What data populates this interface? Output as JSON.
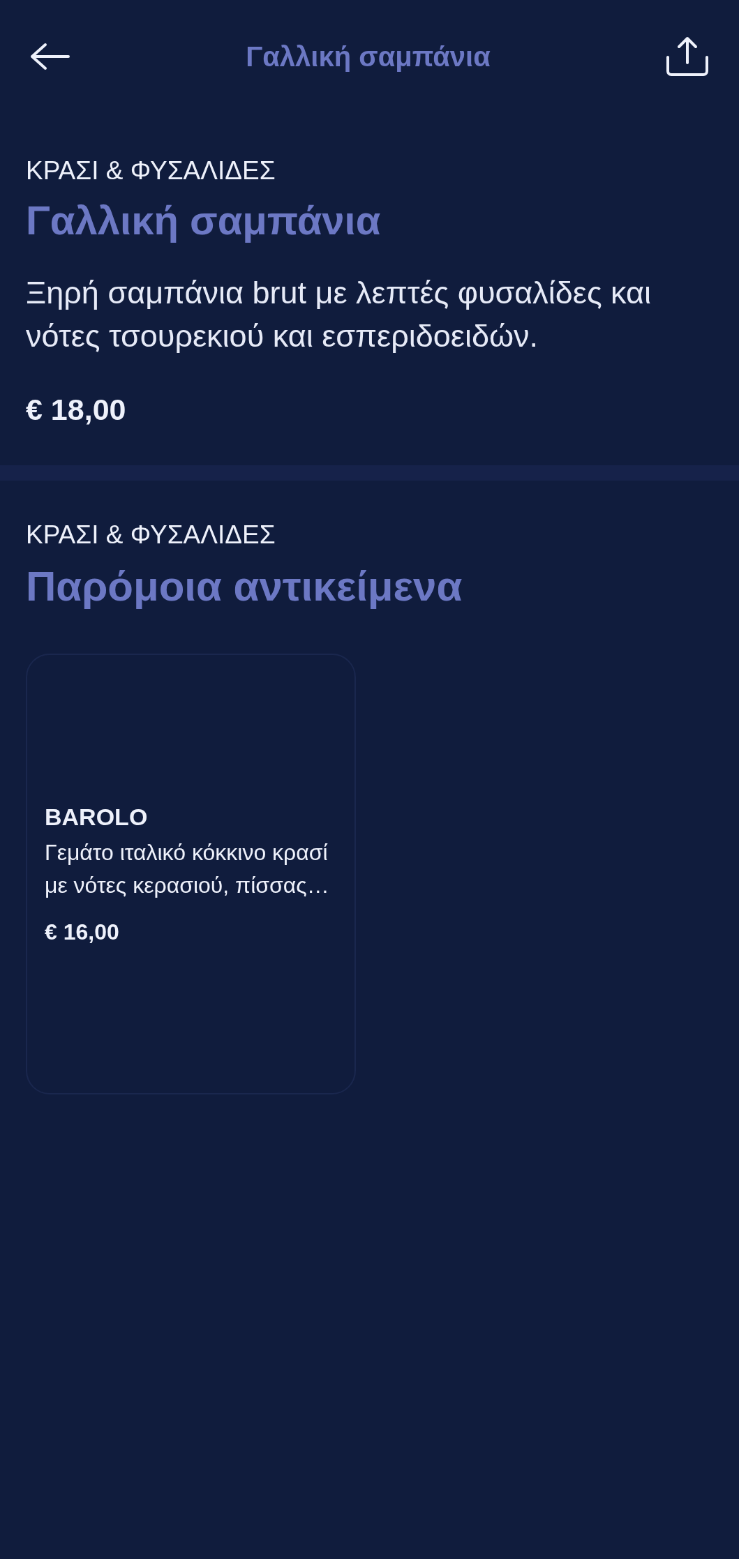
{
  "header": {
    "title": "Γαλλική σαμπάνια"
  },
  "product": {
    "category": "ΚΡΑΣΙ & ΦΥΣΑΛΙΔΕΣ",
    "name": "Γαλλική σαμπάνια",
    "description": "Ξηρή σαμπάνια brut με λεπτές φυσαλίδες και νότες τσουρεκιού και εσπεριδοειδών.",
    "price": "€ 18,00"
  },
  "similar": {
    "category": "ΚΡΑΣΙ & ΦΥΣΑΛΙΔΕΣ",
    "title": "Παρόμοια αντικείμενα",
    "items": [
      {
        "name": "BAROLO",
        "description": "Γεμάτο ιταλικό κόκκινο κρασί με νότες κερασιού, πίσσας…",
        "price": "€ 16,00"
      }
    ]
  }
}
